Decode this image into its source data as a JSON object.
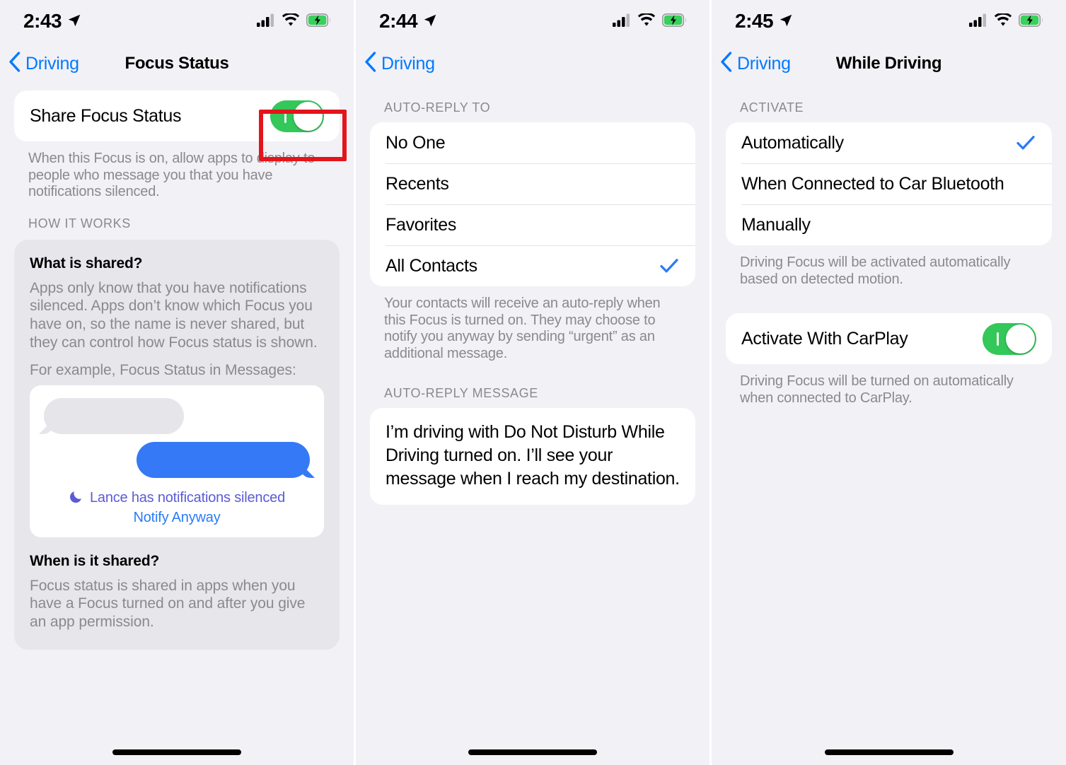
{
  "screens": [
    {
      "status": {
        "time": "2:43",
        "location_icon": "location-arrow-icon",
        "cellular_icon": "cellular-bars-icon",
        "wifi_icon": "wifi-icon",
        "battery_icon": "battery-charging-icon"
      },
      "nav": {
        "back_label": "Driving",
        "title": "Focus Status"
      },
      "share_row": {
        "label": "Share Focus Status",
        "toggle_on": true
      },
      "share_footnote": "When this Focus is on, allow apps to display to people who message you that you have notifications silenced.",
      "how_it_works_header": "HOW IT WORKS",
      "info": {
        "q1_title": "What is shared?",
        "q1_body": "Apps only know that you have notifications silenced. Apps don’t know which Focus you have on, so the name is never shared, but they can control how Focus status is shown.",
        "q1_example": "For example, Focus Status in Messages:",
        "silenced_text": "Lance has notifications silenced",
        "moon_icon": "moon-icon",
        "notify_anyway": "Notify Anyway",
        "q2_title": "When is it shared?",
        "q2_body": "Focus status is shared in apps when you have a Focus turned on and after you give an app permission."
      },
      "highlight_color": "#e4141b"
    },
    {
      "status": {
        "time": "2:44",
        "location_icon": "location-arrow-icon",
        "cellular_icon": "cellular-bars-icon",
        "wifi_icon": "wifi-icon",
        "battery_icon": "battery-charging-icon"
      },
      "nav": {
        "back_label": "Driving",
        "title": ""
      },
      "section_header": "AUTO-REPLY TO",
      "options": [
        {
          "label": "No One",
          "selected": false
        },
        {
          "label": "Recents",
          "selected": false
        },
        {
          "label": "Favorites",
          "selected": false
        },
        {
          "label": "All Contacts",
          "selected": true
        }
      ],
      "footnote": "Your contacts will receive an auto-reply when this Focus is turned on. They may choose to notify you anyway by sending “urgent” as an additional message.",
      "message_header": "AUTO-REPLY MESSAGE",
      "message_value": "I’m driving with Do Not Disturb While Driving turned on. I’ll see your message when I reach my destination."
    },
    {
      "status": {
        "time": "2:45",
        "location_icon": "location-arrow-icon",
        "cellular_icon": "cellular-bars-icon",
        "wifi_icon": "wifi-icon",
        "battery_icon": "battery-charging-icon"
      },
      "nav": {
        "back_label": "Driving",
        "title": "While Driving"
      },
      "section_header": "ACTIVATE",
      "options": [
        {
          "label": "Automatically",
          "selected": true
        },
        {
          "label": "When Connected to Car Bluetooth",
          "selected": false
        },
        {
          "label": "Manually",
          "selected": false
        }
      ],
      "footnote": "Driving Focus will be activated automatically based on detected motion.",
      "carplay_row": {
        "label": "Activate With CarPlay",
        "toggle_on": true
      },
      "carplay_footnote": "Driving Focus will be turned on automatically when connected to CarPlay."
    }
  ],
  "colors": {
    "accent_blue": "#007aff",
    "toggle_green": "#34c759",
    "bubble_blue": "#3579f6",
    "silenced_purple": "#5b5bd6",
    "highlight_red": "#e4141b",
    "background": "#f2f1f6"
  }
}
